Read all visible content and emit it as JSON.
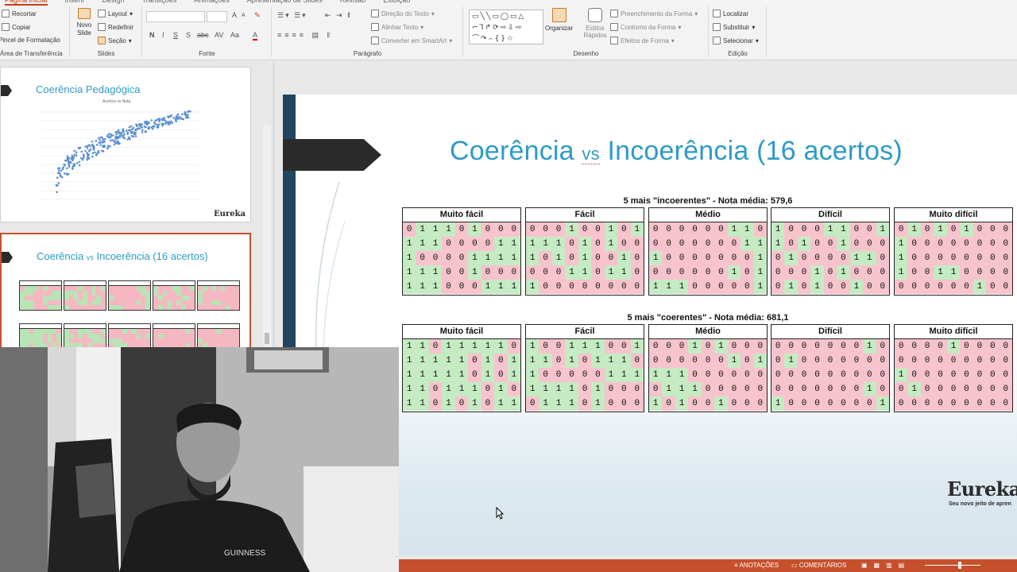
{
  "ribbon": {
    "tabs": [
      "Página Inicial",
      "Inserir",
      "Design",
      "Transições",
      "Animações",
      "Apresentação de Slides",
      "Revisão",
      "Exibição"
    ],
    "clipboard": {
      "recortar": "Recortar",
      "copiar": "Copiar",
      "pincel": "Pincel de Formatação",
      "label": "Área de Transferência"
    },
    "slides": {
      "novo_slide": "Novo Slide",
      "layout": "Layout",
      "redefinir": "Redefinir",
      "secao": "Seção",
      "label": "Slides"
    },
    "fonte": {
      "label": "Fonte",
      "bold": "N",
      "italic": "I",
      "underline": "S",
      "strike": "S",
      "abc": "abc",
      "spacing": "AV",
      "size_up": "A",
      "size_down": "A",
      "case": "Aa",
      "color": "A"
    },
    "paragrafo": {
      "label": "Parágrafo",
      "direcao": "Direção do Texto",
      "alinhar": "Alinhar Texto",
      "smartart": "Converter em SmartArt"
    },
    "desenho": {
      "label": "Desenho",
      "organizar": "Organizar",
      "estilos": "Estilos Rápidos",
      "preenchimento": "Preenchimento da Forma",
      "contorno": "Contorno da Forma",
      "efeitos": "Efeitos de Forma"
    },
    "edicao": {
      "label": "Edição",
      "localizar": "Localizar",
      "substituir": "Substituir",
      "selecionar": "Selecionar"
    }
  },
  "thumbnails": {
    "slide1": {
      "title": "Coerência Pedagógica",
      "subtitle": "Acertos vs Nota",
      "logo": "Eureka"
    },
    "slide2": {
      "title_pre": "Coerência ",
      "title_vs": "vs",
      "title_post": " Incoerência (16 acertos)"
    }
  },
  "slide": {
    "title_pre": "Coerência ",
    "title_vs": "vs",
    "title_post": " Incoerência (16 acertos)",
    "section1": "5 mais \"incoerentes\" - Nota média: 579,6",
    "section2": "5 mais \"coerentes\" - Nota média: 681,1",
    "logo": "Eureka",
    "slogan": "Seu novo jeito de apren",
    "categories": [
      "Muito fácil",
      "Fácil",
      "Médio",
      "Difícil",
      "Muito difícil"
    ]
  },
  "grids": {
    "incoerentes": [
      [
        "011101000",
        "111000011",
        "100001111",
        "111001000",
        "111000111"
      ],
      [
        "000100101",
        "111010100",
        "101010010",
        "000110110",
        "100000000"
      ],
      [
        "000000110",
        "000000011",
        "100000001",
        "000000101",
        "111000001"
      ],
      [
        "100011001",
        "101001000",
        "010000110",
        "000101000",
        "010100100"
      ],
      [
        "010101000",
        "100000000",
        "100000000",
        "100110000",
        "000000100"
      ]
    ],
    "coerentes": [
      [
        "110111110",
        "111110101",
        "111110101",
        "110111010",
        "110101011"
      ],
      [
        "100111001",
        "110101110",
        "100000111",
        "111101000",
        "011101000"
      ],
      [
        "000101000",
        "000000101",
        "111000000",
        "011100000",
        "101001000"
      ],
      [
        "000000010",
        "010000000",
        "000000000",
        "000000010",
        "100000001"
      ],
      [
        "000010000",
        "000000000",
        "100000000",
        "010000000",
        "000000000"
      ]
    ]
  },
  "status": {
    "anotacoes": "ANOTAÇÕES",
    "comentarios": "COMENTÁRIOS"
  }
}
